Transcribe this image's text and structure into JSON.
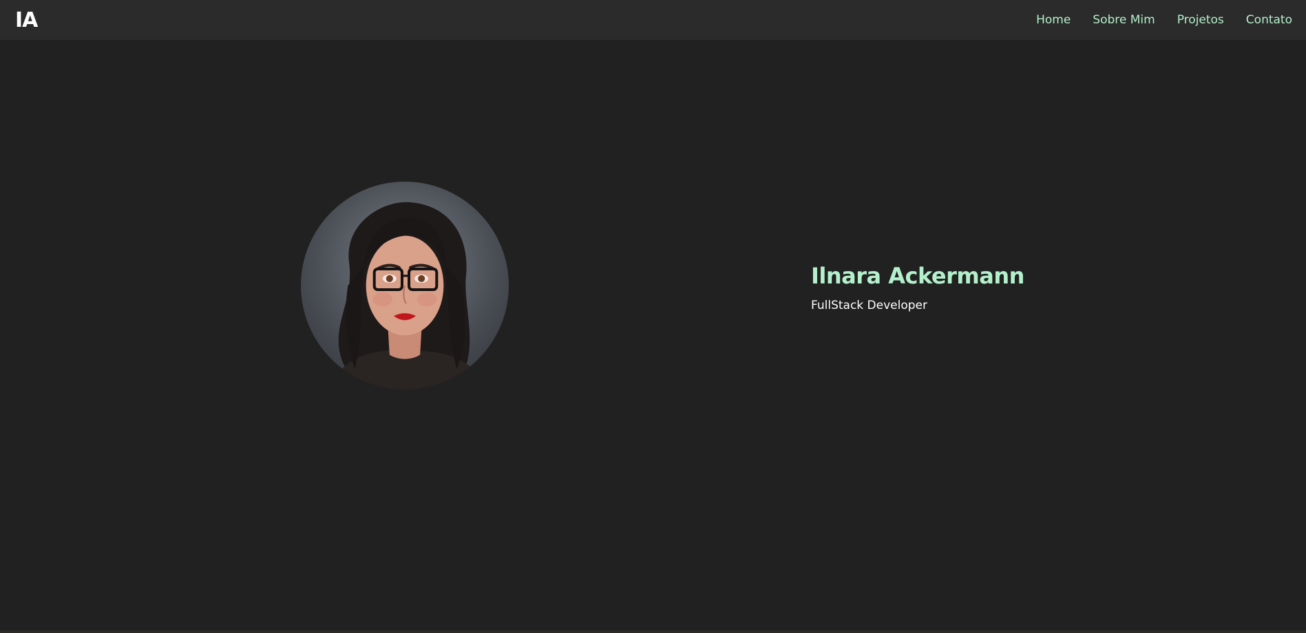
{
  "header": {
    "logo": "IA",
    "nav": [
      {
        "label": "Home"
      },
      {
        "label": "Sobre Mim"
      },
      {
        "label": "Projetos"
      },
      {
        "label": "Contato"
      }
    ]
  },
  "hero": {
    "name": "Ilnara Ackermann",
    "role": "FullStack Developer",
    "avatar_icon": "portrait-photo"
  },
  "colors": {
    "background": "#212121",
    "navbar": "#2b2b2b",
    "accent": "#b4f0cb",
    "text": "#ffffff"
  }
}
